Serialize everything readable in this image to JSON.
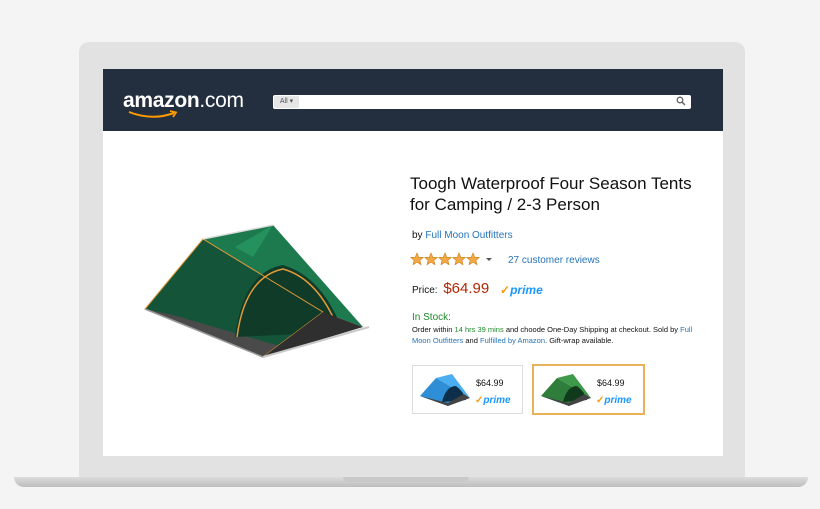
{
  "header": {
    "logo_text": "amazon",
    "logo_tld": ".com",
    "search_category": "All",
    "search_placeholder": ""
  },
  "product": {
    "title": "Toogh Waterproof Four Season Tents for Camping / 2-3 Person",
    "by_prefix": "by",
    "brand": "Full Moon Outfitters",
    "rating": 5,
    "reviews": "27 customer reviews",
    "price_label": "Price:",
    "price": "$64.99",
    "prime_label": "prime",
    "stock": "In Stock:",
    "order": {
      "text1": "Order within",
      "time": "14 hrs 39 mins",
      "text2": "and choode One-Day Shipping at checkout. Sold by",
      "seller": "Full Moon Outfitters",
      "text3": "and",
      "fulfilled": "Fulfilled by Amazon",
      "text4": ". Gift-wrap available."
    },
    "options": [
      {
        "price": "$64.99",
        "prime": "prime",
        "color": "#2f8fd6"
      },
      {
        "price": "$64.99",
        "prime": "prime",
        "color": "#2f7d3a"
      }
    ]
  },
  "colors": {
    "header": "#232f3e",
    "price": "#b12704",
    "link": "#2574b7",
    "stock": "#1e8a2a",
    "prime": "#f39c12",
    "tent": "#1a6b45"
  }
}
